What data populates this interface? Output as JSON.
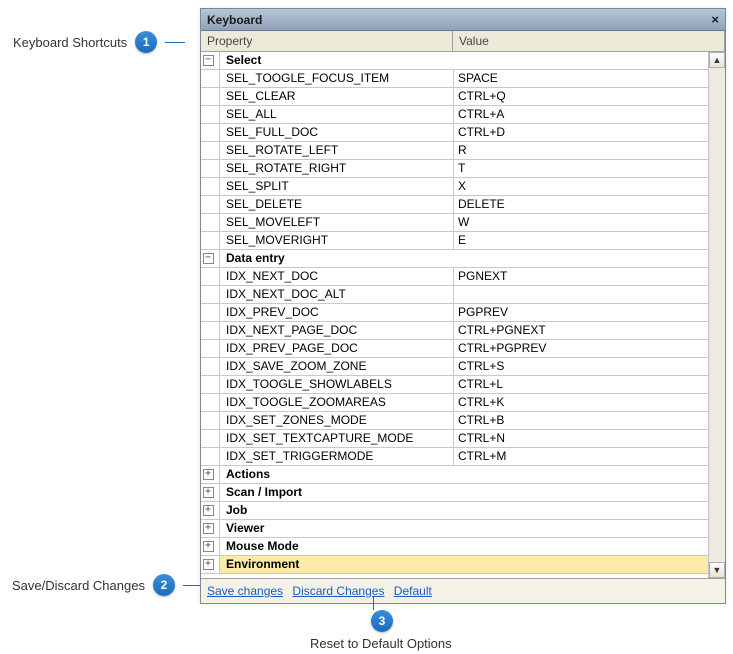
{
  "window": {
    "title": "Keyboard",
    "close": "×"
  },
  "columns": {
    "property": "Property",
    "value": "Value"
  },
  "groups": [
    {
      "label": "Select",
      "expanded": true,
      "rows": [
        {
          "p": "SEL_TOOGLE_FOCUS_ITEM",
          "v": "SPACE"
        },
        {
          "p": "SEL_CLEAR",
          "v": "CTRL+Q"
        },
        {
          "p": "SEL_ALL",
          "v": "CTRL+A"
        },
        {
          "p": "SEL_FULL_DOC",
          "v": "CTRL+D"
        },
        {
          "p": "SEL_ROTATE_LEFT",
          "v": "R"
        },
        {
          "p": "SEL_ROTATE_RIGHT",
          "v": "T"
        },
        {
          "p": "SEL_SPLIT",
          "v": "X"
        },
        {
          "p": "SEL_DELETE",
          "v": "DELETE"
        },
        {
          "p": "SEL_MOVELEFT",
          "v": "W"
        },
        {
          "p": "SEL_MOVERIGHT",
          "v": "E"
        }
      ]
    },
    {
      "label": "Data entry",
      "expanded": true,
      "rows": [
        {
          "p": "IDX_NEXT_DOC",
          "v": "PGNEXT"
        },
        {
          "p": "IDX_NEXT_DOC_ALT",
          "v": ""
        },
        {
          "p": "IDX_PREV_DOC",
          "v": "PGPREV"
        },
        {
          "p": "IDX_NEXT_PAGE_DOC",
          "v": "CTRL+PGNEXT"
        },
        {
          "p": "IDX_PREV_PAGE_DOC",
          "v": "CTRL+PGPREV"
        },
        {
          "p": "IDX_SAVE_ZOOM_ZONE",
          "v": "CTRL+S"
        },
        {
          "p": "IDX_TOOGLE_SHOWLABELS",
          "v": "CTRL+L"
        },
        {
          "p": "IDX_TOOGLE_ZOOMAREAS",
          "v": "CTRL+K"
        },
        {
          "p": "IDX_SET_ZONES_MODE",
          "v": "CTRL+B"
        },
        {
          "p": "IDX_SET_TEXTCAPTURE_MODE",
          "v": "CTRL+N"
        },
        {
          "p": "IDX_SET_TRIGGERMODE",
          "v": "CTRL+M"
        }
      ]
    },
    {
      "label": "Actions",
      "expanded": false,
      "rows": []
    },
    {
      "label": "Scan / Import",
      "expanded": false,
      "rows": []
    },
    {
      "label": "Job",
      "expanded": false,
      "rows": []
    },
    {
      "label": "Viewer",
      "expanded": false,
      "rows": []
    },
    {
      "label": "Mouse Mode",
      "expanded": false,
      "rows": []
    },
    {
      "label": "Environment",
      "expanded": false,
      "highlight": true,
      "rows": []
    }
  ],
  "footer": {
    "save": "Save changes",
    "discard": "Discard Changes",
    "default": "Default"
  },
  "annotations": {
    "a1": {
      "num": "1",
      "text": "Keyboard Shortcuts"
    },
    "a2": {
      "num": "2",
      "text": "Save/Discard Changes"
    },
    "a3": {
      "num": "3",
      "text": "Reset to Default Options"
    }
  }
}
